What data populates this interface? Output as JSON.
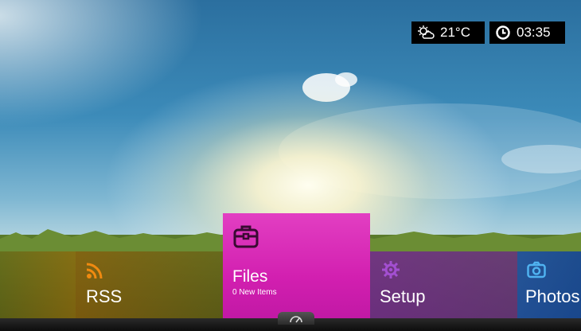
{
  "status": {
    "weather_icon": "partly-cloudy-icon",
    "temperature": "21°C",
    "clock_icon": "clock-icon",
    "time": "03:35"
  },
  "menu": {
    "items": [
      {
        "label": "RSS",
        "icon": "rss-icon",
        "color": "#e08a10"
      },
      {
        "label": "Files",
        "subtitle": "0 New Items",
        "icon": "briefcase-icon",
        "color": "#d825b6"
      },
      {
        "label": "Setup",
        "icon": "gear-icon",
        "color": "#8a3aa8"
      },
      {
        "label": "Photos",
        "icon": "camera-icon",
        "color": "#1f5fb4"
      }
    ]
  },
  "bottom": {
    "handle_icon": "dashboard-gauge-icon"
  }
}
